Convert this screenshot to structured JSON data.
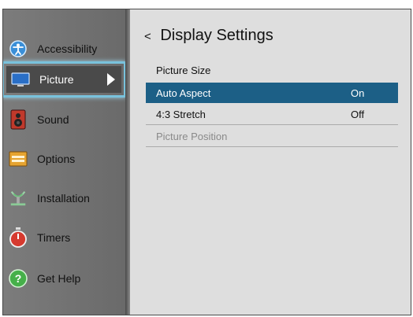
{
  "sidebar": {
    "items": [
      {
        "label": "Accessibility",
        "icon": "accessibility-icon"
      },
      {
        "label": "Picture",
        "icon": "tv-icon"
      },
      {
        "label": "Sound",
        "icon": "speaker-icon"
      },
      {
        "label": "Options",
        "icon": "options-icon"
      },
      {
        "label": "Installation",
        "icon": "antenna-icon"
      },
      {
        "label": "Timers",
        "icon": "timer-icon"
      },
      {
        "label": "Get Help",
        "icon": "help-icon"
      }
    ],
    "active_index": 1
  },
  "main": {
    "back_glyph": "<",
    "title": "Display Settings",
    "rows": [
      {
        "label": "Picture Size",
        "value": ""
      },
      {
        "label": "Auto Aspect",
        "value": "On"
      },
      {
        "label": "4:3 Stretch",
        "value": "Off"
      },
      {
        "label": "Picture Position",
        "value": ""
      }
    ]
  },
  "colors": {
    "accent_focus": "#79c2dc",
    "selected_row": "#1c5f86",
    "sidebar_bg": "#6e6e6e",
    "content_bg": "#dedede"
  }
}
